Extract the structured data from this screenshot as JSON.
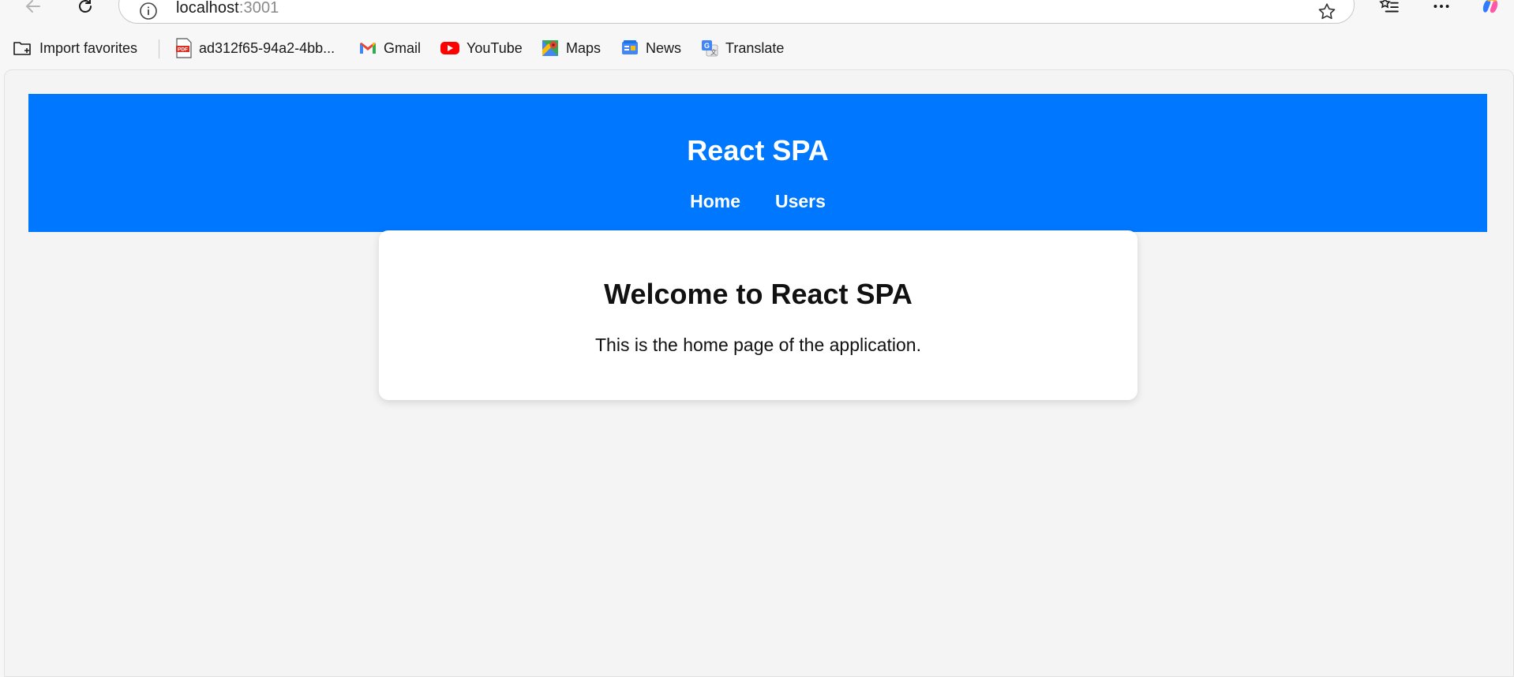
{
  "browser": {
    "url_host": "localhost",
    "url_port": ":3001"
  },
  "favorites": [
    {
      "label": "Import favorites",
      "icon": "import-favorites-icon"
    },
    {
      "label": "ad312f65-94a2-4bb...",
      "icon": "pdf-icon"
    },
    {
      "label": "Gmail",
      "icon": "gmail-icon"
    },
    {
      "label": "YouTube",
      "icon": "youtube-icon"
    },
    {
      "label": "Maps",
      "icon": "maps-icon"
    },
    {
      "label": "News",
      "icon": "news-icon"
    },
    {
      "label": "Translate",
      "icon": "translate-icon"
    }
  ],
  "app": {
    "title": "React SPA",
    "nav": [
      {
        "label": "Home"
      },
      {
        "label": "Users"
      }
    ],
    "header_color": "#0077ff"
  },
  "content": {
    "heading": "Welcome to React SPA",
    "body": "This is the home page of the application."
  }
}
